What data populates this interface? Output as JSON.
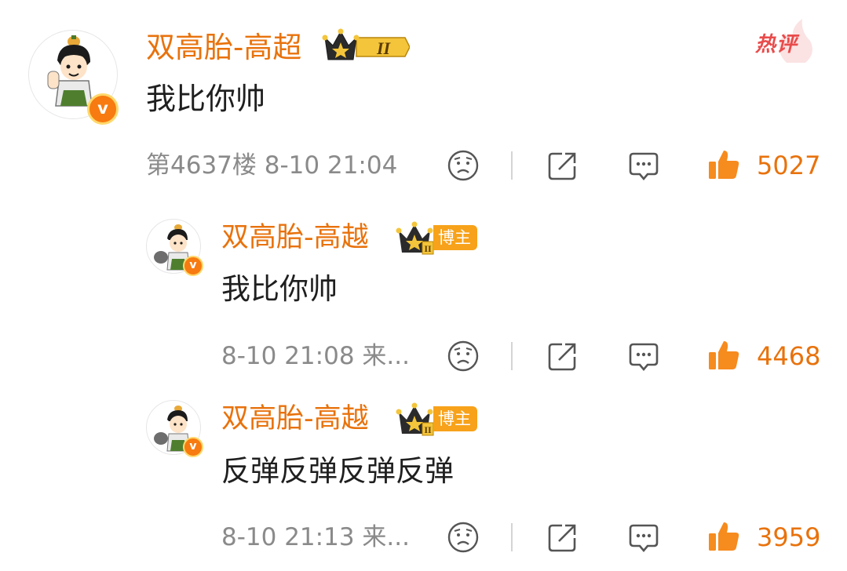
{
  "main_comment": {
    "author": "双高胎-高超",
    "level_badge": "II",
    "hot_label": "热评",
    "text": "我比你帅",
    "floor": "第4637楼",
    "time": "8-10 21:04",
    "likes": "5027"
  },
  "replies": [
    {
      "author": "双高胎-高越",
      "blogger_tag": "博主",
      "text": "我比你帅",
      "time": "8-10 21:08",
      "source": "来...",
      "likes": "4468"
    },
    {
      "author": "双高胎-高越",
      "blogger_tag": "博主",
      "text": "反弹反弹反弹反弹",
      "time": "8-10 21:13",
      "source": "来...",
      "likes": "3959"
    }
  ],
  "colors": {
    "accent": "#e8720c",
    "meta_text": "#8a8a8a",
    "hot_red": "#e94b4b"
  },
  "icons": [
    "sad-face-icon",
    "share-icon",
    "comment-icon",
    "thumbs-up-icon",
    "crown-icon",
    "verified-v-icon"
  ]
}
